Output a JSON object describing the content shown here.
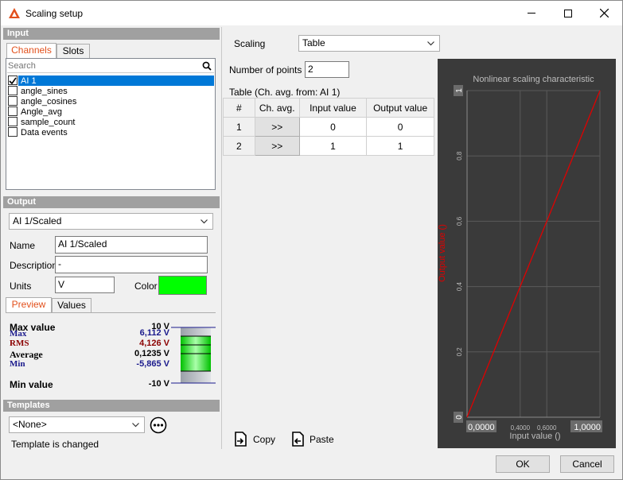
{
  "window": {
    "title": "Scaling setup"
  },
  "input": {
    "header": "Input",
    "tabs": [
      "Channels",
      "Slots"
    ],
    "search_placeholder": "Search",
    "channels": [
      {
        "label": "AI 1",
        "checked": true,
        "selected": true
      },
      {
        "label": "angle_sines",
        "checked": false,
        "selected": false
      },
      {
        "label": "angle_cosines",
        "checked": false,
        "selected": false
      },
      {
        "label": "Angle_avg",
        "checked": false,
        "selected": false
      },
      {
        "label": "sample_count",
        "checked": false,
        "selected": false
      },
      {
        "label": "Data events",
        "checked": false,
        "selected": false
      }
    ]
  },
  "output": {
    "header": "Output",
    "channel": "AI 1/Scaled",
    "name_label": "Name",
    "name_value": "AI 1/Scaled",
    "description_label": "Description",
    "description_value": "-",
    "units_label": "Units",
    "units_value": "V",
    "color_label": "Color",
    "color_value": "#00ff00",
    "tabs": [
      "Preview",
      "Values"
    ]
  },
  "preview": {
    "max_value_label": "Max value",
    "max_value": "10 V",
    "max_label": "Max",
    "max": "6,112 V",
    "rms_label": "RMS",
    "rms": "4,126 V",
    "average_label": "Average",
    "average": "0,1235 V",
    "min_label": "Min",
    "min": "-5,865 V",
    "min_value_label": "Min value",
    "min_value": "-10 V"
  },
  "templates": {
    "header": "Templates",
    "selected": "<None>",
    "status": "Template is changed"
  },
  "scaling": {
    "label": "Scaling",
    "value": "Table",
    "points_label": "Number of points",
    "points_value": "2",
    "table_caption": "Table (Ch. avg. from: AI 1)",
    "columns": [
      "#",
      "Ch. avg.",
      "Input value",
      "Output value"
    ],
    "rows": [
      {
        "n": "1",
        "btn": ">>",
        "input": "0",
        "output": "0"
      },
      {
        "n": "2",
        "btn": ">>",
        "input": "1",
        "output": "1"
      }
    ],
    "copy_label": "Copy",
    "paste_label": "Paste"
  },
  "chart_data": {
    "type": "line",
    "title": "Nonlinear scaling characteristic",
    "xlabel": "Input value ()",
    "ylabel": "Output value ()",
    "xlim": [
      0,
      1
    ],
    "ylim": [
      0,
      1
    ],
    "x_tick_labels": [
      "0,0000",
      "0,4000",
      "0,6000",
      "1,0000"
    ],
    "y_tick_labels": [
      "0",
      "0,2",
      "0,4",
      "0,6",
      "0,8",
      "1"
    ],
    "series": [
      {
        "x": [
          0,
          1
        ],
        "y": [
          0,
          1
        ],
        "color": "#e00000"
      }
    ],
    "grid": true
  },
  "footer": {
    "ok": "OK",
    "cancel": "Cancel"
  }
}
